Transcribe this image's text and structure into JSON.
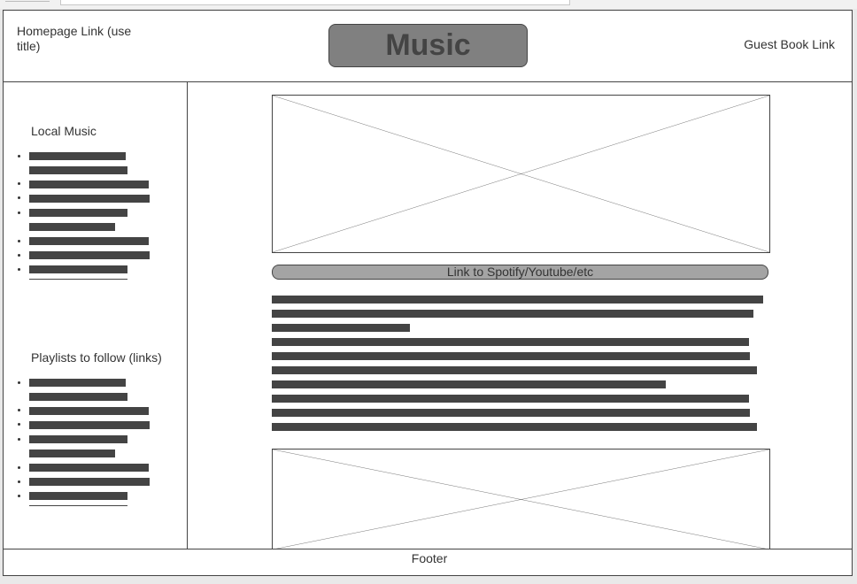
{
  "header": {
    "home_link": "Homepage Link (use title)",
    "title": "Music",
    "guest_link": "Guest Book Link"
  },
  "sidebar": {
    "local_music_heading": "Local Music",
    "playlists_heading": "Playlists to follow (links)"
  },
  "main": {
    "stream_link": "Link to Spotify/Youtube/etc"
  },
  "footer": {
    "text": "Footer"
  }
}
